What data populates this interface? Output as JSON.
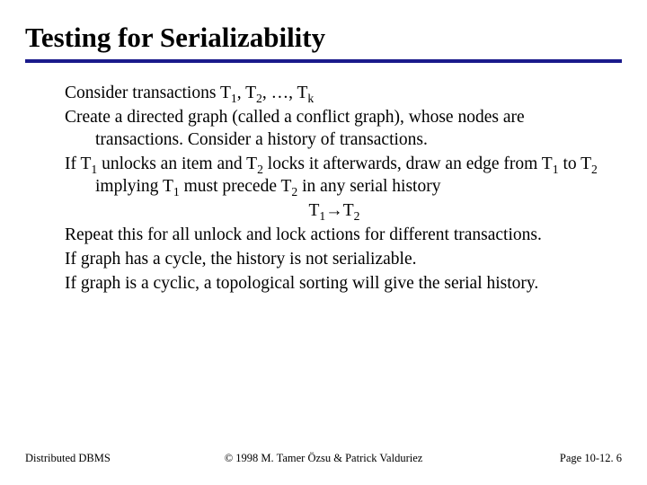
{
  "title": "Testing for Serializability",
  "body": {
    "p1_a": "Consider transactions T",
    "p1_b": ", T",
    "p1_c": ", …, T",
    "s1": "1",
    "s2": "2",
    "sk": "k",
    "p2": "Create a directed graph (called a conflict graph), whose nodes are transactions. Consider a history of transactions.",
    "p3_a": "If T",
    "p3_b": " unlocks an item and T",
    "p3_c": " locks it afterwards, draw an edge from T",
    "p3_d": " to T",
    "p3_e": " implying T",
    "p3_f": " must precede T",
    "p3_g": " in any serial history",
    "p4_a": "T",
    "p4_arrow": "→",
    "p4_b": "T",
    "p5": "Repeat this for all unlock and lock actions for different transactions.",
    "p6": "If graph has a cycle, the history is not serializable.",
    "p7": "If graph is a cyclic, a topological sorting will give the serial history."
  },
  "footer": {
    "left": "Distributed DBMS",
    "center": "© 1998 M. Tamer Özsu & Patrick Valduriez",
    "right": "Page 10-12. 6"
  }
}
